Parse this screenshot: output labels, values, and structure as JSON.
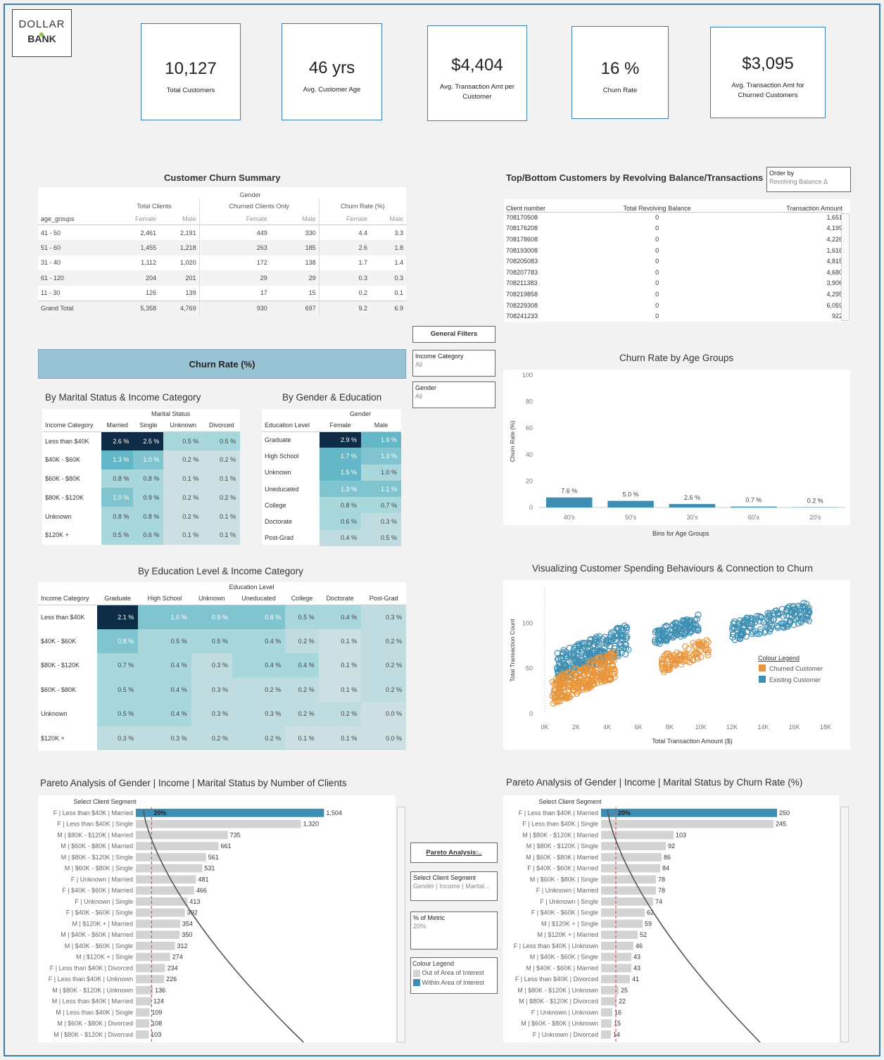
{
  "logo": {
    "line1": "DOLLAR",
    "line2": "BANK"
  },
  "kpis": [
    {
      "value": "10,127",
      "caption": "Total Customers"
    },
    {
      "value": "46 yrs",
      "caption": "Avg. Customer Age"
    },
    {
      "value": "$4,404",
      "caption": "Avg. Transaction Amt per Customer"
    },
    {
      "value": "16 %",
      "caption": "Churn Rate"
    },
    {
      "value": "$3,095",
      "caption": "Avg. Transaction Amt for Churned Customers"
    }
  ],
  "churn_summary": {
    "title": "Customer Churn Summary",
    "gender_header": "Gender",
    "groups": [
      "Total Clients",
      "Churned Clients Only",
      "Churn Rate (%)"
    ],
    "row_header": "age_groups",
    "sub": [
      "Female",
      "Male"
    ],
    "rows": [
      [
        "41 - 50",
        "2,461",
        "2,191",
        "449",
        "330",
        "4.4",
        "3.3"
      ],
      [
        "51 - 60",
        "1,455",
        "1,218",
        "263",
        "185",
        "2.6",
        "1.8"
      ],
      [
        "31 - 40",
        "1,112",
        "1,020",
        "172",
        "138",
        "1.7",
        "1.4"
      ],
      [
        "61 - 120",
        "204",
        "201",
        "29",
        "29",
        "0.3",
        "0.3"
      ],
      [
        "11 - 30",
        "126",
        "139",
        "17",
        "15",
        "0.2",
        "0.1"
      ],
      [
        "Grand Total",
        "5,358",
        "4,769",
        "930",
        "697",
        "9.2",
        "6.9"
      ]
    ]
  },
  "top_bottom": {
    "title": "Top/Bottom Customers by Revolving Balance/Transactions",
    "order_by_label": "Order by",
    "order_by_value": "Revolving Balance Δ",
    "columns": [
      "Client number",
      "Total Revolving Balance",
      "Transaction Amount"
    ],
    "rows": [
      [
        "708170508",
        "0",
        "1,651"
      ],
      [
        "708176208",
        "0",
        "4,199"
      ],
      [
        "708178608",
        "0",
        "4,226"
      ],
      [
        "708193008",
        "0",
        "1,616"
      ],
      [
        "708205083",
        "0",
        "4,815"
      ],
      [
        "708207783",
        "0",
        "4,680"
      ],
      [
        "708211383",
        "0",
        "3,906"
      ],
      [
        "708219858",
        "0",
        "4,295"
      ],
      [
        "708229308",
        "0",
        "6,059"
      ],
      [
        "708241233",
        "0",
        "922"
      ]
    ]
  },
  "filters": {
    "title": "General Filters",
    "income_label": "Income Category",
    "income_value": "All",
    "gender_label": "Gender",
    "gender_value": "All"
  },
  "churn_band": "Churn Rate (%)",
  "marital_income": {
    "title": "By Marital Status & Income Category",
    "group_header": "Marital Status",
    "row_header": "Income Category",
    "columns": [
      "Married",
      "Single",
      "Unknown",
      "Divorced"
    ],
    "rows": [
      [
        "Less than $40K",
        "2.6 %",
        "2.5 %",
        "0.5 %",
        "0.5 %"
      ],
      [
        "$40K - $60K",
        "1.3 %",
        "1.0 %",
        "0.2 %",
        "0.2 %"
      ],
      [
        "$60K - $80K",
        "0.8 %",
        "0.8 %",
        "0.1 %",
        "0.1 %"
      ],
      [
        "$80K - $120K",
        "1.0 %",
        "0.9 %",
        "0.2 %",
        "0.2 %"
      ],
      [
        "Unknown",
        "0.8 %",
        "0.8 %",
        "0.2 %",
        "0.1 %"
      ],
      [
        "$120K +",
        "0.5 %",
        "0.6 %",
        "0.1 %",
        "0.1 %"
      ]
    ]
  },
  "gender_education": {
    "title": "By Gender & Education",
    "group_header": "Gender",
    "row_header": "Education Level",
    "columns": [
      "Female",
      "Male"
    ],
    "rows": [
      [
        "Graduate",
        "2.9 %",
        "1.9 %"
      ],
      [
        "High School",
        "1.7 %",
        "1.3 %"
      ],
      [
        "Unknown",
        "1.5 %",
        "1.0 %"
      ],
      [
        "Uneducated",
        "1.3 %",
        "1.1 %"
      ],
      [
        "College",
        "0.8 %",
        "0.7 %"
      ],
      [
        "Doctorate",
        "0.6 %",
        "0.3 %"
      ],
      [
        "Post-Grad",
        "0.4 %",
        "0.5 %"
      ]
    ]
  },
  "education_income": {
    "title": "By Education Level & Income Category",
    "group_header": "Education Level",
    "row_header": "Income Category",
    "columns": [
      "Graduate",
      "High School",
      "Unknown",
      "Uneducated",
      "College",
      "Doctorate",
      "Post-Grad"
    ],
    "rows": [
      [
        "Less than $40K",
        "2.1 %",
        "1.0 %",
        "0.9 %",
        "0.8 %",
        "0.5 %",
        "0.4 %",
        "0.3 %"
      ],
      [
        "$40K - $60K",
        "0.8 %",
        "0.5 %",
        "0.5 %",
        "0.4 %",
        "0.2 %",
        "0.1 %",
        "0.2 %"
      ],
      [
        "$80K - $120K",
        "0.7 %",
        "0.4 %",
        "0.3 %",
        "0.4 %",
        "0.4 %",
        "0.1 %",
        "0.2 %"
      ],
      [
        "$60K - $80K",
        "0.5 %",
        "0.4 %",
        "0.3 %",
        "0.2 %",
        "0.2 %",
        "0.1 %",
        "0.2 %"
      ],
      [
        "Unknown",
        "0.5 %",
        "0.4 %",
        "0.3 %",
        "0.3 %",
        "0.2 %",
        "0.2 %",
        "0.0 %"
      ],
      [
        "$120K +",
        "0.3 %",
        "0.3 %",
        "0.2 %",
        "0.2 %",
        "0.1 %",
        "0.1 %",
        "0.0 %"
      ]
    ]
  },
  "pareto_controls": {
    "title": "Pareto Analysis:..",
    "segment_label": "Select Client Segment",
    "segment_value": "Gender | Income | Marital ..",
    "metric_label": "% of Metric",
    "metric_value": "20%",
    "legend_title": "Colour Legend",
    "legend_out": "Out of Area of Interest",
    "legend_in": "Within Area of Interest"
  },
  "colors": {
    "accent_blue": "#3b7fb0",
    "bar_blue": "#3d8eb3",
    "churned_orange": "#e8953a",
    "existing_blue": "#3d8eb3",
    "grey_bar": "#d3d3d3",
    "ref_red": "#d9534f"
  },
  "chart_data": [
    {
      "type": "bar",
      "title": "Churn Rate by Age Groups",
      "xlabel": "Bins for Age Groups",
      "ylabel": "Churn Rate (%)",
      "ylim": [
        0,
        100
      ],
      "yticks": [
        "0",
        "20",
        "40",
        "60",
        "80",
        "100"
      ],
      "categories": [
        "40's",
        "50's",
        "30's",
        "60's",
        "20's"
      ],
      "values": [
        7.6,
        5.0,
        2.6,
        0.7,
        0.2
      ],
      "labels": [
        "7.6 %",
        "5.0 %",
        "2.6 %",
        "0.7 %",
        "0.2 %"
      ]
    },
    {
      "type": "scatter",
      "title": "Visualizing Customer Spending Behaviours & Connection to Churn",
      "xlabel": "Total Transaction Amount ($)",
      "ylabel": "Total Transaction Count",
      "xticks": [
        "0K",
        "2K",
        "4K",
        "6K",
        "8K",
        "10K",
        "12K",
        "14K",
        "16K",
        "18K"
      ],
      "yticks": [
        "0",
        "50",
        "100"
      ],
      "xlim": [
        0,
        18000
      ],
      "ylim": [
        0,
        140
      ],
      "legend_title": "Colour Legend",
      "series": [
        {
          "name": "Churned Customer",
          "clusters": [
            {
              "x": [
                500,
                4500
              ],
              "y": [
                10,
                70
              ],
              "n": 260
            },
            {
              "x": [
                7500,
                10500
              ],
              "y": [
                45,
                85
              ],
              "n": 90
            }
          ]
        },
        {
          "name": "Existing Customer",
          "clusters": [
            {
              "x": [
                800,
                5400
              ],
              "y": [
                35,
                100
              ],
              "n": 280
            },
            {
              "x": [
                7000,
                9900
              ],
              "y": [
                75,
                110
              ],
              "n": 110
            },
            {
              "x": [
                12000,
                17000
              ],
              "y": [
                80,
                125
              ],
              "n": 170
            }
          ]
        }
      ]
    },
    {
      "type": "bar",
      "title": "Pareto Analysis of Gender | Income | Marital Status by Number of Clients",
      "axis_header": "Select Client Segment",
      "ref_label": "20%",
      "highlight_count": 1,
      "categories": [
        "F | Less than $40K | Married",
        "F | Less than $40K | Single",
        "M | $80K - $120K | Married",
        "M | $60K - $80K | Married",
        "M | $80K - $120K | Single",
        "M | $60K - $80K | Single",
        "F | Unknown | Married",
        "F | $40K - $60K | Married",
        "F | Unknown | Single",
        "F | $40K - $60K | Single",
        "M | $120K + | Married",
        "M | $40K - $60K | Married",
        "M | $40K - $60K | Single",
        "M | $120K + | Single",
        "F | Less than $40K | Divorced",
        "F | Less than $40K | Unknown",
        "M | $80K - $120K | Unknown",
        "M | Less than $40K | Married",
        "M | Less than $40K | Single",
        "M | $60K - $80K | Divorced",
        "M | $80K - $120K | Divorced"
      ],
      "values": [
        1504,
        1320,
        735,
        661,
        561,
        531,
        481,
        466,
        413,
        392,
        354,
        350,
        312,
        274,
        234,
        226,
        136,
        124,
        109,
        108,
        103
      ],
      "labels": [
        "1,504",
        "1,320",
        "735",
        "661",
        "561",
        "531",
        "481",
        "466",
        "413",
        "392",
        "354",
        "350",
        "312",
        "274",
        "234",
        "226",
        "136",
        "124",
        "109",
        "108",
        "103"
      ],
      "xlim": [
        0,
        1800
      ]
    },
    {
      "type": "bar",
      "title": "Pareto Analysis of Gender | Income | Marital Status by Churn Rate (%)",
      "axis_header": "Select Client Segment",
      "ref_label": "20%",
      "highlight_count": 1,
      "categories": [
        "F | Less than $40K | Married",
        "F | Less than $40K | Single",
        "M | $80K - $120K | Married",
        "M | $80K - $120K | Single",
        "M | $60K - $80K | Married",
        "F | $40K - $60K | Married",
        "M | $60K - $80K | Single",
        "F | Unknown | Married",
        "F | Unknown | Single",
        "F | $40K - $60K | Single",
        "M | $120K + | Single",
        "M | $120K + | Married",
        "F | Less than $40K | Unknown",
        "M | $40K - $60K | Single",
        "M | $40K - $60K | Married",
        "F | Less than $40K | Divorced",
        "M | $80K - $120K | Unknown",
        "M | $80K - $120K | Divorced",
        "F | Unknown | Unknown",
        "M | $60K - $80K | Unknown",
        "F | Unknown | Divorced"
      ],
      "values": [
        250,
        245,
        103,
        92,
        86,
        84,
        78,
        78,
        74,
        62,
        59,
        52,
        46,
        43,
        43,
        41,
        25,
        22,
        16,
        15,
        14
      ],
      "labels": [
        "250",
        "245",
        "103",
        "92",
        "86",
        "84",
        "78",
        "78",
        "74",
        "62",
        "59",
        "52",
        "46",
        "43",
        "43",
        "41",
        "25",
        "22",
        "16",
        "15",
        "14"
      ],
      "xlim": [
        0,
        300
      ]
    }
  ]
}
